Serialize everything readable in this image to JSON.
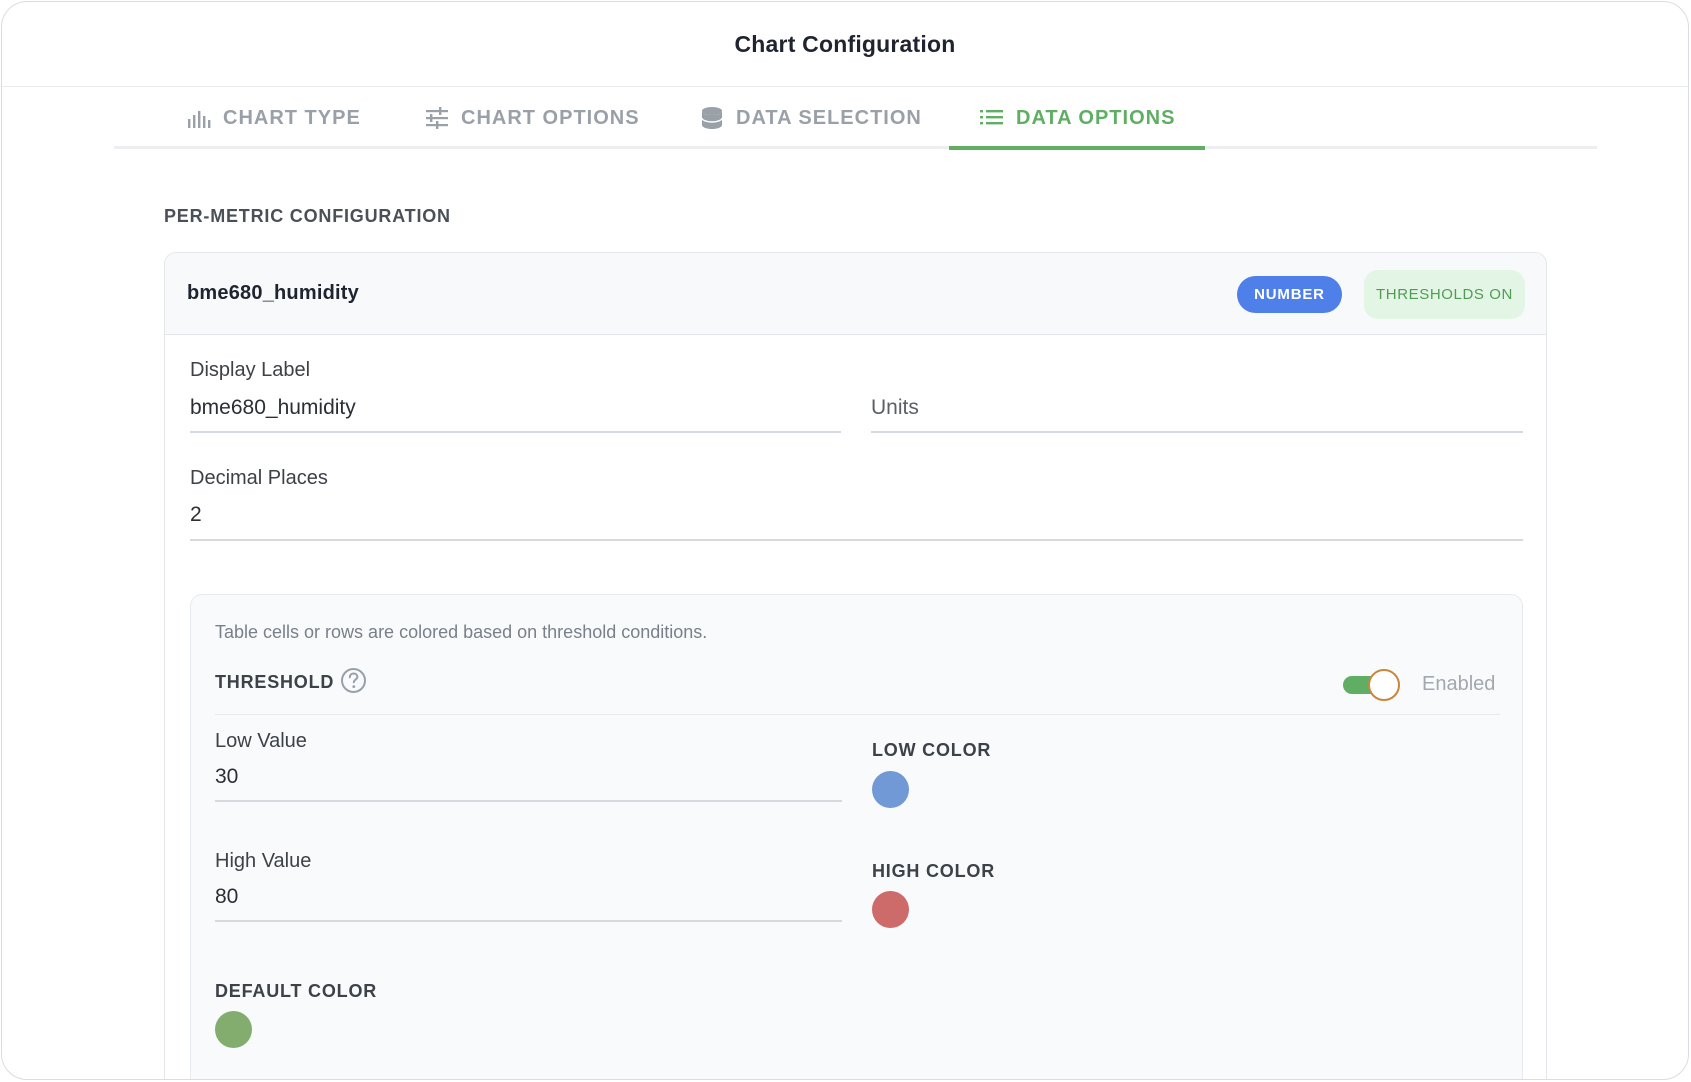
{
  "header": {
    "title": "Chart Configuration"
  },
  "tabs": [
    {
      "label": "CHART TYPE",
      "icon": "bar-chart-icon",
      "active": false
    },
    {
      "label": "CHART OPTIONS",
      "icon": "sliders-icon",
      "active": false
    },
    {
      "label": "DATA SELECTION",
      "icon": "database-icon",
      "active": false
    },
    {
      "label": "DATA OPTIONS",
      "icon": "list-icon",
      "active": true
    }
  ],
  "section": {
    "title": "PER-METRIC CONFIGURATION"
  },
  "metric": {
    "name": "bme680_humidity",
    "type_badge": "NUMBER",
    "thresholds_badge": "THRESHOLDS ON",
    "display_label": {
      "label": "Display Label",
      "value": "bme680_humidity"
    },
    "units": {
      "placeholder": "Units",
      "value": ""
    },
    "decimal_places": {
      "label": "Decimal Places",
      "value": "2"
    }
  },
  "threshold": {
    "help_text": "Table cells or rows are colored based on threshold conditions.",
    "title": "THRESHOLD",
    "enabled": true,
    "enabled_label": "Enabled",
    "low_value": {
      "label": "Low Value",
      "value": "30"
    },
    "high_value": {
      "label": "High Value",
      "value": "80"
    },
    "low_color": {
      "label": "LOW COLOR",
      "color": "#7199d6"
    },
    "high_color": {
      "label": "HIGH COLOR",
      "color": "#cd6a6a"
    },
    "default_color": {
      "label": "DEFAULT COLOR",
      "color": "#82ad6e"
    }
  },
  "colors": {
    "accent": "#5fae63",
    "badge_blue": "#4f7fe8",
    "tab_inactive": "#9aa0a8"
  }
}
